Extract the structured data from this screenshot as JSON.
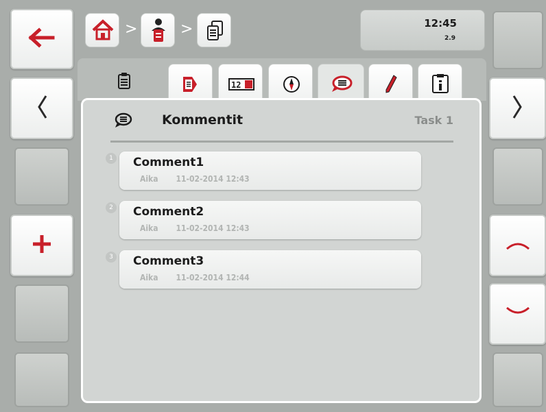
{
  "header": {
    "clock": "12:45",
    "version": "2.9",
    "breadcrumb_separator": ">"
  },
  "tabs": [
    {
      "name": "tab-task-overview",
      "icon": "clipboard-icon"
    },
    {
      "name": "tab-task-data",
      "icon": "document-arrow-icon"
    },
    {
      "name": "tab-counters",
      "icon": "counter-icon"
    },
    {
      "name": "tab-navigation",
      "icon": "compass-icon"
    },
    {
      "name": "tab-comments",
      "icon": "speech-bubble-icon",
      "active": true
    },
    {
      "name": "tab-notes",
      "icon": "pencil-icon"
    },
    {
      "name": "tab-info",
      "icon": "info-icon"
    }
  ],
  "panel": {
    "title": "Kommentit",
    "task_label": "Task 1"
  },
  "comments": [
    {
      "index": "1",
      "title": "Comment1",
      "time_label": "Aika",
      "timestamp": "11-02-2014 12:43"
    },
    {
      "index": "2",
      "title": "Comment2",
      "time_label": "Aika",
      "timestamp": "11-02-2014 12:43"
    },
    {
      "index": "3",
      "title": "Comment3",
      "time_label": "Aika",
      "timestamp": "11-02-2014 12:44"
    }
  ],
  "softkeys": {
    "left": [
      "back-arrow-icon",
      "chevron-left-icon",
      "",
      "plus-icon",
      "",
      ""
    ],
    "right": [
      "",
      "chevron-right-icon",
      "",
      "chevron-up-icon",
      "chevron-down-icon",
      ""
    ]
  },
  "colors": {
    "accent_red": "#d0202a",
    "background": "#a9adaa",
    "panel": "#d2d5d3"
  }
}
